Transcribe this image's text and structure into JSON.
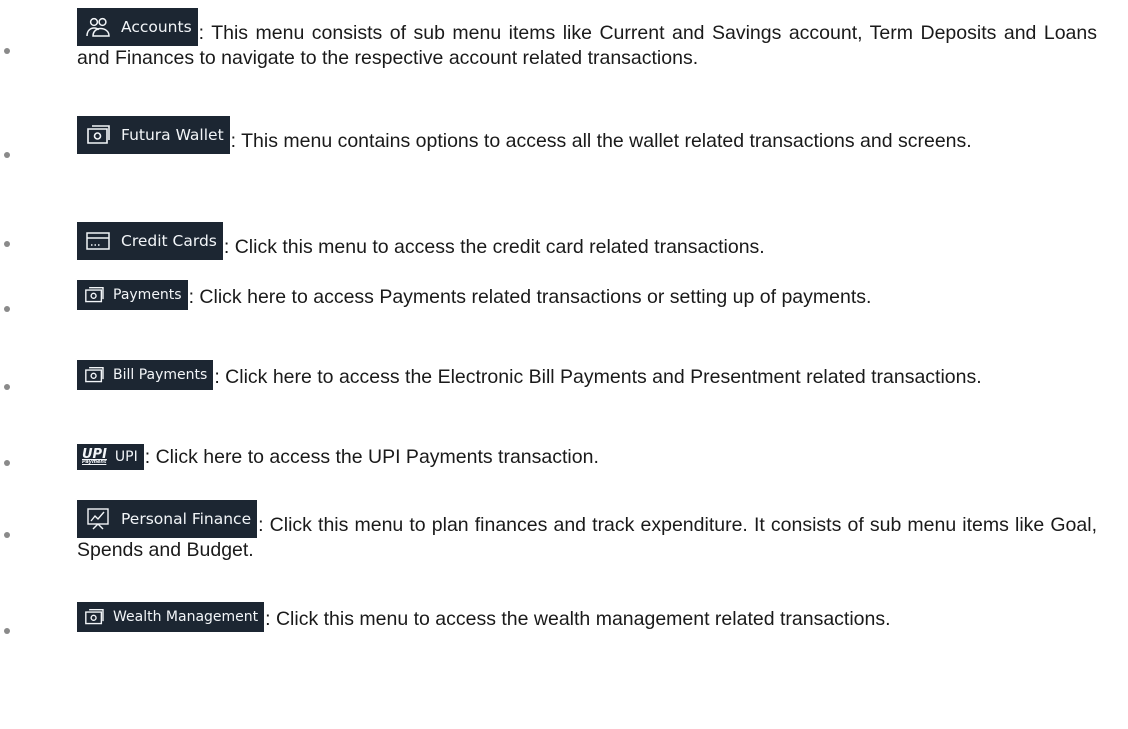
{
  "items": [
    {
      "menu_label": "Accounts",
      "icon": "users-icon",
      "description": ": This menu consists of sub menu items like Current and Savings account, Term Deposits and Loans and Finances to navigate to the respective account related transactions."
    },
    {
      "menu_label": "Futura Wallet",
      "icon": "wallet-icon",
      "description": ": This menu contains options to access all the wallet related transactions and screens."
    },
    {
      "menu_label": "Credit Cards",
      "icon": "credit-card-icon",
      "description": ": Click this menu to access the credit card related transactions."
    },
    {
      "menu_label": "Payments",
      "icon": "payments-icon",
      "description": ": Click here to access Payments related transactions or setting up of payments."
    },
    {
      "menu_label": "Bill Payments",
      "icon": "bill-payments-icon",
      "description": ": Click here to access the Electronic Bill Payments and Presentment related transactions."
    },
    {
      "menu_label": "UPI",
      "icon": "upi-logo-icon",
      "icon_text": "UPI",
      "icon_subtext": "Payment",
      "description": ": Click here to access the UPI Payments transaction."
    },
    {
      "menu_label": "Personal Finance",
      "icon": "chart-presentation-icon",
      "description": ": Click this menu to plan finances and track expenditure. It consists of sub menu items like Goal, Spends and Budget."
    },
    {
      "menu_label": "Wealth Management",
      "icon": "wealth-management-icon",
      "description": ": Click this menu to access the wealth management related transactions."
    }
  ],
  "colors": {
    "chip_background": "#1c2632",
    "chip_text": "#f2f5f8",
    "body_text": "#1a1a1a",
    "bullet": "#8a8a8a"
  }
}
